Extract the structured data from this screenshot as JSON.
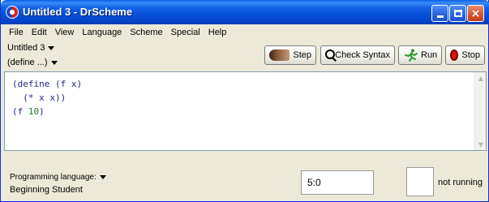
{
  "window": {
    "title": "Untitled 3 - DrScheme",
    "controls": {
      "close_glyph": "×"
    }
  },
  "menubar": {
    "items": [
      {
        "label": "File"
      },
      {
        "label": "Edit"
      },
      {
        "label": "View"
      },
      {
        "label": "Language"
      },
      {
        "label": "Scheme"
      },
      {
        "label": "Special"
      },
      {
        "label": "Help"
      }
    ]
  },
  "toolbar": {
    "document_name": "Untitled 3",
    "define_menu": "(define ...)",
    "step_label": "Step",
    "check_syntax_label": "Check Syntax",
    "run_label": "Run",
    "stop_label": "Stop"
  },
  "editor": {
    "lines": [
      "(define (f x)",
      "  (* x x))",
      "",
      "(f 10)"
    ],
    "scroll_up_glyph": "▲",
    "scroll_down_glyph": "▼"
  },
  "status": {
    "language_label": "Programming language:",
    "language_value": "Beginning Student",
    "cursor_position": "5:0",
    "run_state": "not running"
  },
  "colors": {
    "titlebar": "#0650d8",
    "keyword": "#26268c",
    "number": "#2a7a2a"
  }
}
